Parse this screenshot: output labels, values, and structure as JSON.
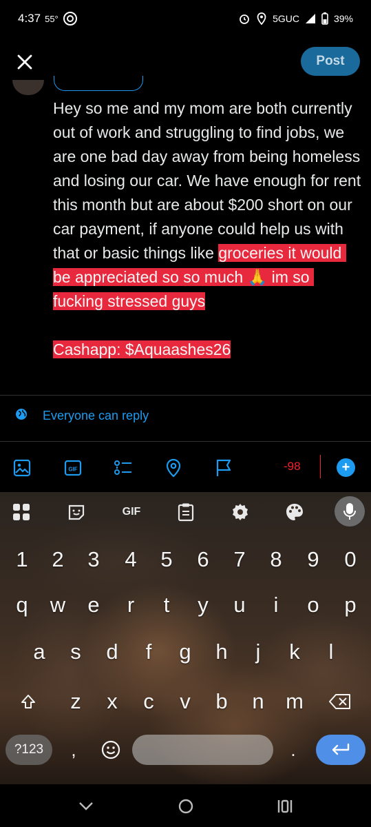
{
  "status_bar": {
    "time": "4:37",
    "temperature": "55°",
    "network": "5GUC",
    "battery": "39%"
  },
  "header": {
    "post_label": "Post"
  },
  "compose": {
    "text_plain": "Hey so me and my mom are both currently out of work and struggling to find jobs, we are one bad day away from being homeless and losing our car. We have enough for rent this month but are about $200 short on our car payment, if anyone could help us with that or basic things like ",
    "text_highlighted": "groceries it would be appreciated so so much 🙏 im so fucking stressed guys",
    "cashapp_line": "Cashapp: $Aquaashes26"
  },
  "reply_setting": {
    "label": "Everyone can reply"
  },
  "toolbar": {
    "char_count": "-98"
  },
  "keyboard": {
    "gif_label": "GIF",
    "number_row": [
      "1",
      "2",
      "3",
      "4",
      "5",
      "6",
      "7",
      "8",
      "9",
      "0"
    ],
    "row1": [
      "q",
      "w",
      "e",
      "r",
      "t",
      "y",
      "u",
      "i",
      "o",
      "p"
    ],
    "row2": [
      "a",
      "s",
      "d",
      "f",
      "g",
      "h",
      "j",
      "k",
      "l"
    ],
    "row3": [
      "z",
      "x",
      "c",
      "v",
      "b",
      "n",
      "m"
    ],
    "symbols_label": "?123",
    "comma": ",",
    "period": "."
  },
  "colors": {
    "accent": "#1d9bf0",
    "highlight": "#e8283c",
    "error": "#f4212e",
    "post_button": "#1a6a9b"
  }
}
